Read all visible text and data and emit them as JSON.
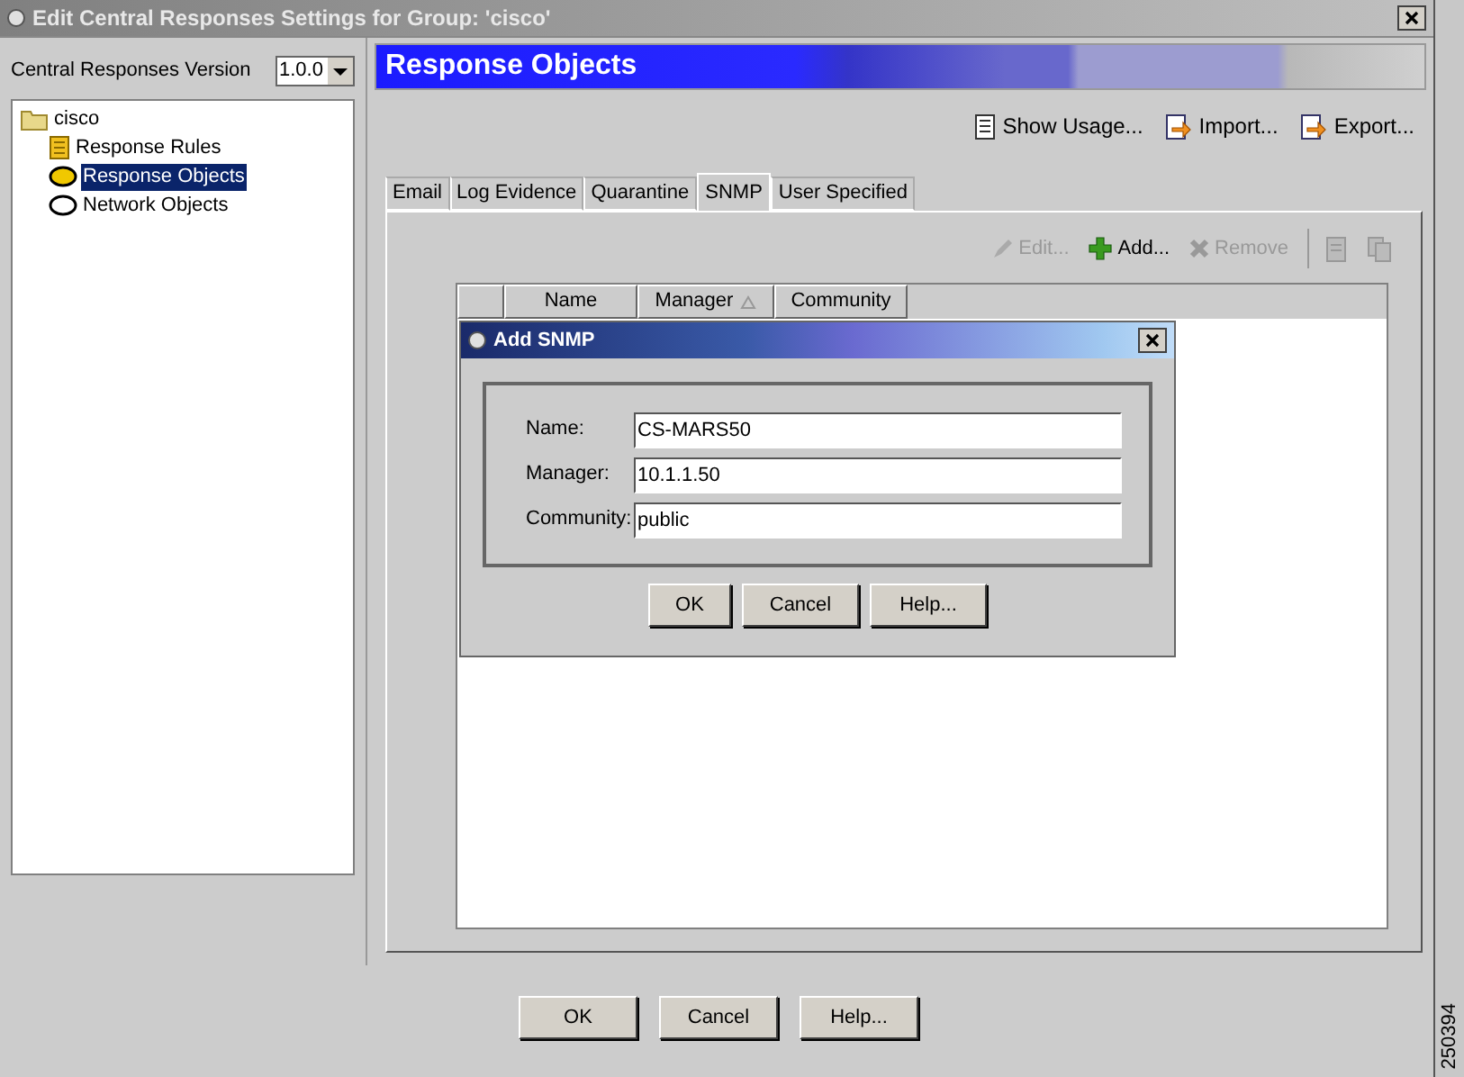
{
  "window": {
    "title": "Edit Central Responses Settings for Group: 'cisco'"
  },
  "version": {
    "label": "Central Responses Version",
    "value": "1.0.0"
  },
  "tree": [
    {
      "label": "cisco",
      "kind": "folder",
      "selected": false,
      "children": [
        {
          "label": "Response Rules",
          "kind": "rules",
          "selected": false
        },
        {
          "label": "Response Objects",
          "kind": "object",
          "selected": true
        },
        {
          "label": "Network Objects",
          "kind": "network",
          "selected": false
        }
      ]
    }
  ],
  "header": {
    "title": "Response Objects"
  },
  "actions": [
    {
      "label": "Show Usage...",
      "kind": "usage"
    },
    {
      "label": "Import...",
      "kind": "import"
    },
    {
      "label": "Export...",
      "kind": "export"
    }
  ],
  "tabs": [
    {
      "label": "Email",
      "selected": false
    },
    {
      "label": "Log Evidence",
      "selected": false
    },
    {
      "label": "Quarantine",
      "selected": false
    },
    {
      "label": "SNMP",
      "selected": true
    },
    {
      "label": "User Specified",
      "selected": false
    }
  ],
  "table_toolbar": [
    {
      "label": "Edit...",
      "kind": "edit",
      "disabled": true
    },
    {
      "label": "Add...",
      "kind": "add",
      "disabled": false
    },
    {
      "label": "Remove",
      "kind": "remove",
      "disabled": true
    },
    {
      "kind": "copy",
      "disabled": true
    },
    {
      "kind": "paste",
      "disabled": true
    }
  ],
  "table": {
    "columns": [
      {},
      {
        "label": "Name"
      },
      {
        "label": "Manager",
        "sorted": true
      },
      {
        "label": "Community"
      }
    ]
  },
  "dialog": {
    "title": "Add SNMP",
    "fields": [
      {
        "label": "Name:",
        "value": "CS-MARS50"
      },
      {
        "label": "Manager:",
        "value": "10.1.1.50"
      },
      {
        "label": "Community:",
        "value": "public"
      }
    ],
    "buttons": [
      "OK",
      "Cancel",
      "Help..."
    ]
  },
  "buttons": [
    "OK",
    "Cancel",
    "Help..."
  ],
  "figure_number": "250394"
}
